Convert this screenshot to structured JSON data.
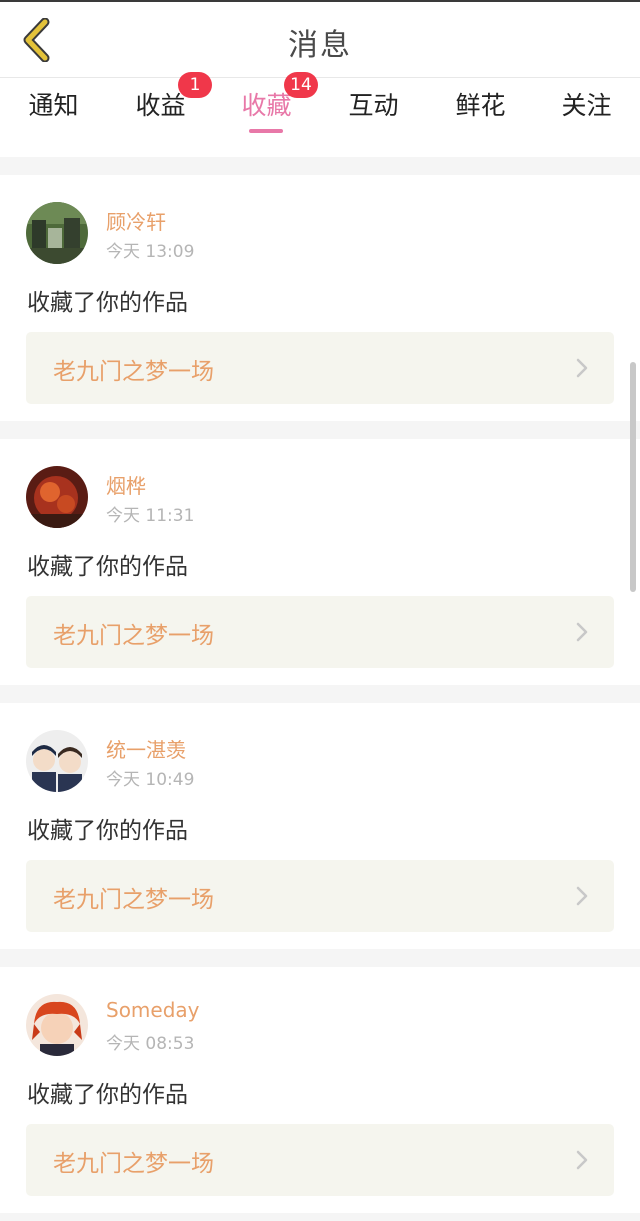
{
  "header": {
    "title": "消息",
    "back_icon": "chevron-left-icon",
    "back_color": "#e3c23a"
  },
  "tabs": [
    {
      "label": "通知",
      "badge": null,
      "active": false
    },
    {
      "label": "收益",
      "badge": "1",
      "active": false
    },
    {
      "label": "收藏",
      "badge": "14",
      "active": true
    },
    {
      "label": "互动",
      "badge": null,
      "active": false
    },
    {
      "label": "鲜花",
      "badge": null,
      "active": false
    },
    {
      "label": "关注",
      "badge": null,
      "active": false
    }
  ],
  "colors": {
    "accent": "#e878a8",
    "badge": "#f0374a",
    "username": "#e8a06a",
    "work_box": "#f5f5ee"
  },
  "messages": [
    {
      "username": "顾冷轩",
      "time": "今天 13:09",
      "action": "收藏了你的作品",
      "work_title": "老九门之梦一场"
    },
    {
      "username": "烟桦",
      "time": "今天 11:31",
      "action": "收藏了你的作品",
      "work_title": "老九门之梦一场"
    },
    {
      "username": "统一湛羡",
      "time": "今天 10:49",
      "action": "收藏了你的作品",
      "work_title": "老九门之梦一场"
    },
    {
      "username": "Someday",
      "time": "今天 08:53",
      "action": "收藏了你的作品",
      "work_title": "老九门之梦一场"
    }
  ]
}
